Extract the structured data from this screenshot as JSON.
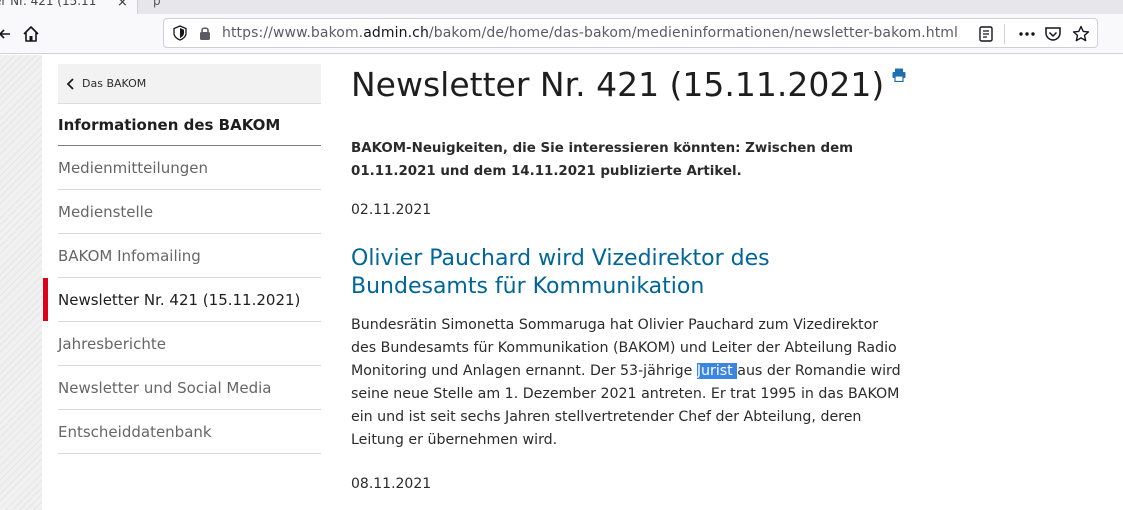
{
  "browser": {
    "tab_title": "er Nr. 421 (15.11",
    "tab_close": "×",
    "next_tab_fragment": "p",
    "url_prefix": "https://www.bakom.",
    "url_domain": "admin.ch",
    "url_path": "/bakom/de/home/das-bakom/medieninformationen/newsletter-bakom.html",
    "toolbar_icons": [
      "back-icon",
      "home-icon",
      "shield-icon",
      "lock-icon",
      "reader-view-icon",
      "more-icon",
      "pocket-icon",
      "bookmark-star-icon"
    ]
  },
  "sidebar": {
    "back_label": "Das BAKOM",
    "section_title": "Informationen des BAKOM",
    "items": [
      {
        "label": "Medienmitteilungen",
        "active": false
      },
      {
        "label": "Medienstelle",
        "active": false
      },
      {
        "label": "BAKOM Infomailing",
        "active": false
      },
      {
        "label": "Newsletter Nr. 421 (15.11.2021)",
        "active": true
      },
      {
        "label": "Jahresberichte",
        "active": false
      },
      {
        "label": "Newsletter und Social Media",
        "active": false
      },
      {
        "label": "Entscheiddatenbank",
        "active": false
      }
    ],
    "accent_color": "#dc0018"
  },
  "main": {
    "title": "Newsletter Nr. 421 (15.11.2021)",
    "lead": "BAKOM-Neuigkeiten, die Sie interessieren könnten: Zwischen dem 01.11.2021 und dem 14.11.2021 publizierte Artikel.",
    "date1": "02.11.2021",
    "article_title": "Olivier Pauchard wird Vizedirektor des Bundesamts für Kommunikation",
    "article_body_before": "Bundesrätin Simonetta Sommaruga hat Olivier Pauchard zum Vizedirektor des Bundesamts für Kommunikation (BAKOM) und Leiter der Abteilung Radio Monitoring und Anlagen ernannt. Der 53-jährige ",
    "article_body_highlight": "Jurist ",
    "article_body_after": "aus der Romandie wird seine neue Stelle am 1. Dezember 2021 antreten. Er trat 1995 in das BAKOM ein und ist seit sechs Jahren stellvertretender Chef der Abteilung, deren Leitung er übernehmen wird.",
    "date2": "08.11.2021",
    "link_color": "#006699",
    "selection_color": "#3b86e2"
  }
}
